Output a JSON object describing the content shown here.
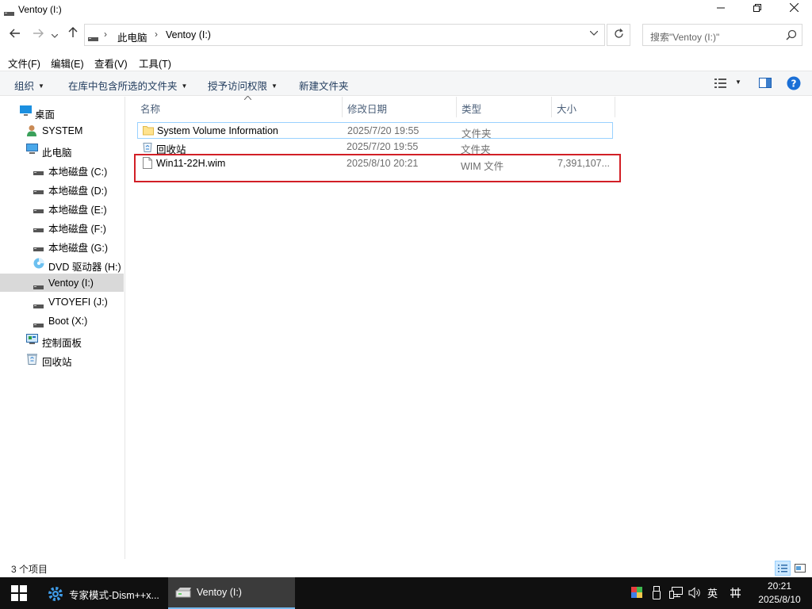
{
  "window": {
    "title": "Ventoy (I:)"
  },
  "address": {
    "crumbs": [
      "此电脑",
      "Ventoy (I:)"
    ]
  },
  "search": {
    "placeholder": "搜索\"Ventoy (I:)\""
  },
  "menu": {
    "items": [
      "文件(F)",
      "编辑(E)",
      "查看(V)",
      "工具(T)"
    ]
  },
  "commands": {
    "organize": "组织",
    "include_library": "在库中包含所选的文件夹",
    "share": "授予访问权限",
    "new_folder": "新建文件夹"
  },
  "nav": {
    "items": [
      {
        "label": "桌面",
        "icon": "desktop-icon"
      },
      {
        "label": "SYSTEM",
        "icon": "user-icon"
      },
      {
        "label": "此电脑",
        "icon": "computer-icon"
      },
      {
        "label": "本地磁盘 (C:)",
        "icon": "drive-icon"
      },
      {
        "label": "本地磁盘 (D:)",
        "icon": "drive-icon"
      },
      {
        "label": "本地磁盘 (E:)",
        "icon": "drive-icon"
      },
      {
        "label": "本地磁盘 (F:)",
        "icon": "drive-icon"
      },
      {
        "label": "本地磁盘 (G:)",
        "icon": "drive-icon"
      },
      {
        "label": "DVD 驱动器 (H:)",
        "icon": "dvd-icon"
      },
      {
        "label": "Ventoy (I:)",
        "icon": "drive-icon",
        "selected": true
      },
      {
        "label": "VTOYEFI (J:)",
        "icon": "drive-icon"
      },
      {
        "label": "Boot (X:)",
        "icon": "drive-icon"
      },
      {
        "label": "控制面板",
        "icon": "control-panel-icon"
      },
      {
        "label": "回收站",
        "icon": "recycle-bin-icon"
      }
    ]
  },
  "columns": {
    "name": "名称",
    "modified": "修改日期",
    "type": "类型",
    "size": "大小"
  },
  "files": [
    {
      "name": "System Volume Information",
      "modified": "2025/7/20 19:55",
      "type": "文件夹",
      "size": "",
      "icon": "folder-icon"
    },
    {
      "name": "回收站",
      "modified": "2025/7/20 19:55",
      "type": "文件夹",
      "size": "",
      "icon": "recycle-bin-icon"
    },
    {
      "name": "Win11-22H.wim",
      "modified": "2025/8/10 20:21",
      "type": "WIM 文件",
      "size": "7,391,107...",
      "icon": "file-icon"
    }
  ],
  "status": {
    "count": "3 个项目"
  },
  "taskbar": {
    "apps": [
      "专家模式-Dism++x...",
      "Ventoy (I:)"
    ],
    "ime": "英",
    "time": "20:21",
    "date": "2025/8/10"
  },
  "colors": {
    "highlight_box": "#d21f26",
    "selection": "#cce8ff",
    "taskbar": "#101010"
  }
}
